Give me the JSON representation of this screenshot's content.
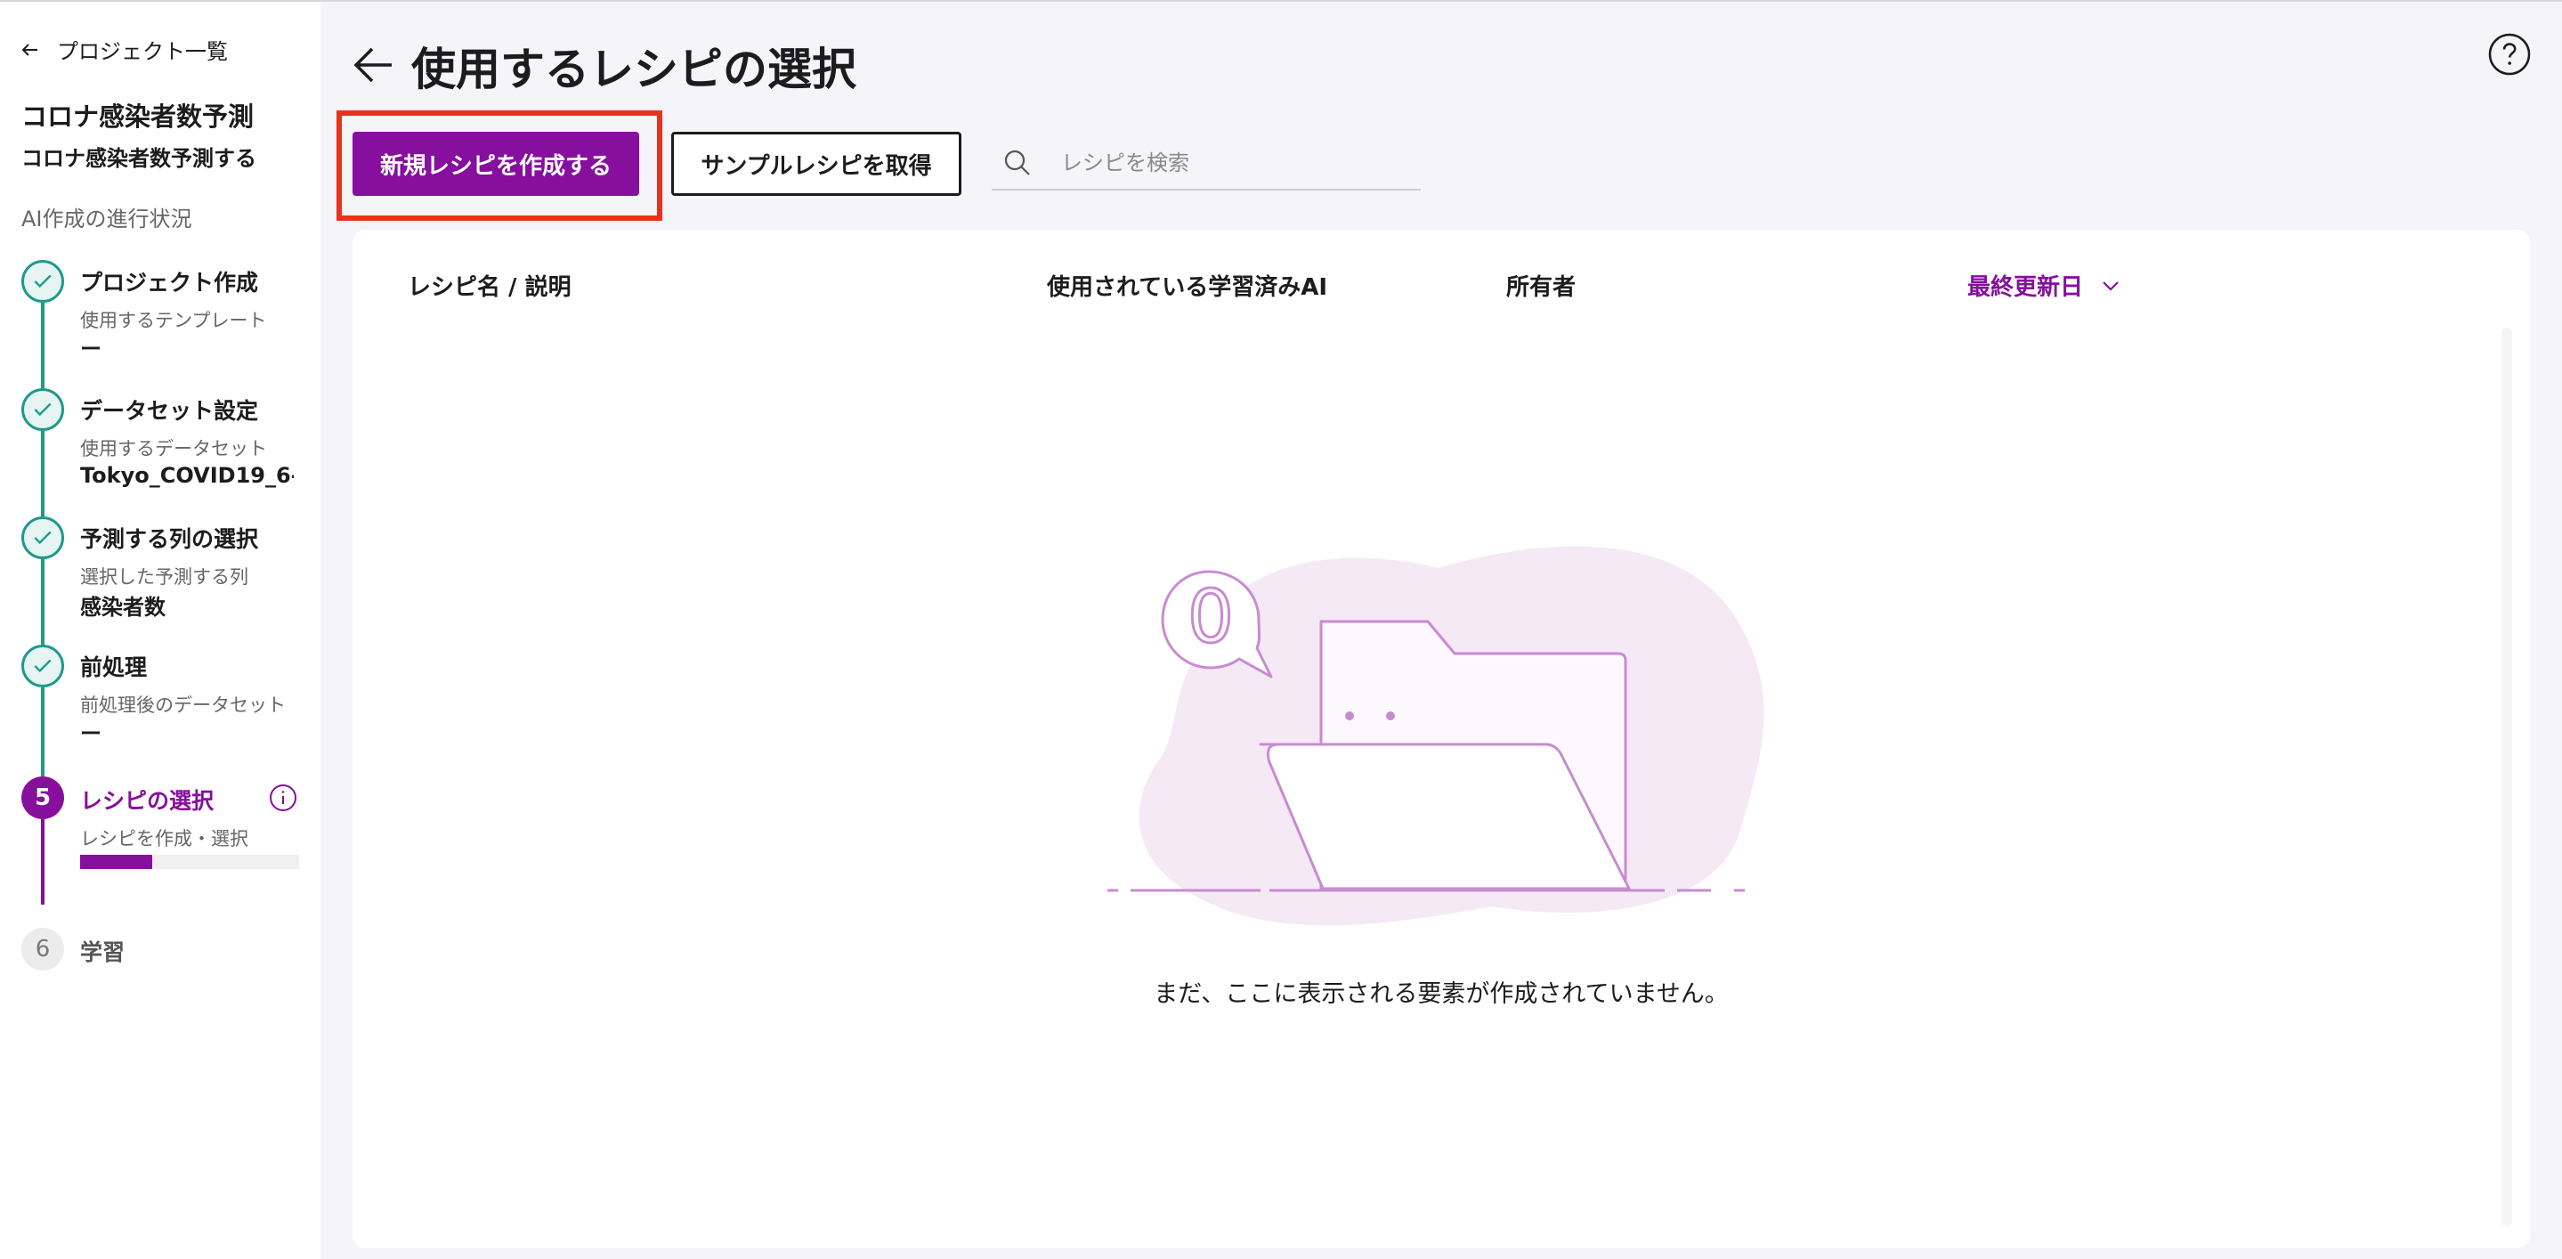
{
  "sidebar": {
    "back_label": "プロジェクト一覧",
    "project_title": "コロナ感染者数予測",
    "project_desc": "コロナ感染者数予測する",
    "progress_heading": "AI作成の進行状況",
    "steps": [
      {
        "title": "プロジェクト作成",
        "sub": "使用するテンプレート",
        "value": "ー"
      },
      {
        "title": "データセット設定",
        "sub": "使用するデータセット",
        "value": "Tokyo_COVID19_6-..."
      },
      {
        "title": "予測する列の選択",
        "sub": "選択した予測する列",
        "value": "感染者数"
      },
      {
        "title": "前処理",
        "sub": "前処理後のデータセット",
        "value": "ー"
      },
      {
        "number": "5",
        "title": "レシピの選択",
        "sub": "レシピを作成・選択",
        "progress": 0.33
      },
      {
        "number": "6",
        "title": "学習"
      }
    ]
  },
  "main": {
    "title": "使用するレシピの選択",
    "create_button": "新規レシピを作成する",
    "sample_button": "サンプルレシピを取得",
    "search_placeholder": "レシピを検索",
    "table": {
      "col_name": "レシピ名 / 説明",
      "col_ai": "使用されている学習済みAI",
      "col_owner": "所有者",
      "col_updated": "最終更新日"
    },
    "empty_count": "0",
    "empty_message": "まだ、ここに表示される要素が作成されていません。"
  },
  "colors": {
    "accent": "#860f9e",
    "done": "#1f9a8a",
    "highlight": "#e8321f"
  }
}
